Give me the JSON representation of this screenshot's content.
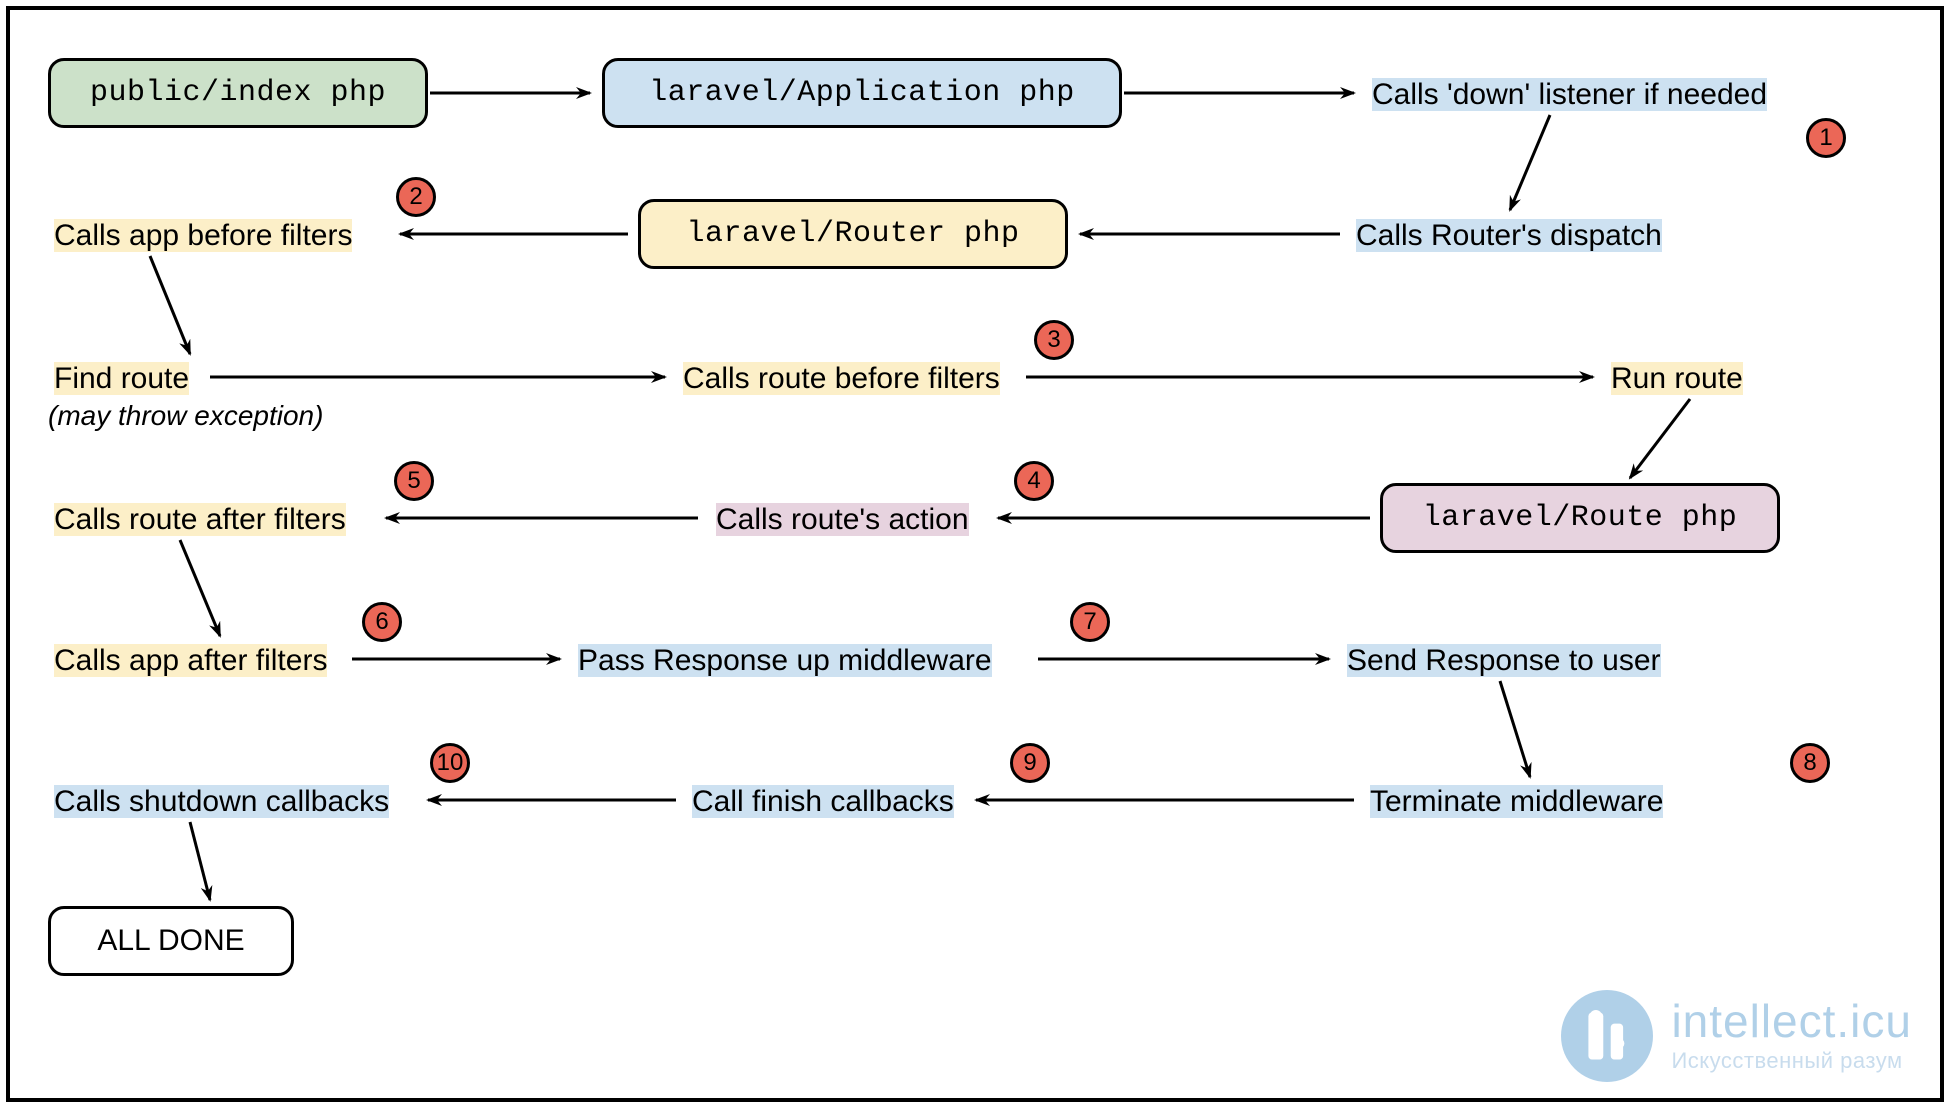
{
  "nodes": {
    "n1": {
      "label": "public/index php"
    },
    "n2": {
      "label": "laravel/Application php"
    },
    "n3": {
      "label": "Calls 'down' listener if needed"
    },
    "n4": {
      "label": "Calls Router's dispatch"
    },
    "n5": {
      "label": "laravel/Router php"
    },
    "n6": {
      "label": "Calls app before filters"
    },
    "n7": {
      "label": "Find route",
      "note": "(may throw exception)"
    },
    "n8": {
      "label": "Calls route before filters"
    },
    "n9": {
      "label": "Run route"
    },
    "n10": {
      "label": "laravel/Route php"
    },
    "n11": {
      "label": "Calls route's action"
    },
    "n12": {
      "label": "Calls route after filters"
    },
    "n13": {
      "label": "Calls app after filters"
    },
    "n14": {
      "label": "Pass Response up middleware"
    },
    "n15": {
      "label": "Send Response to user"
    },
    "n16": {
      "label": "Terminate middleware"
    },
    "n17": {
      "label": "Call finish callbacks"
    },
    "n18": {
      "label": "Calls shutdown callbacks"
    },
    "n19": {
      "label": "ALL DONE"
    }
  },
  "badges": {
    "b1": "1",
    "b2": "2",
    "b3": "3",
    "b4": "4",
    "b5": "5",
    "b6": "6",
    "b7": "7",
    "b8": "8",
    "b9": "9",
    "b10": "10"
  },
  "watermark": {
    "brand": "intellect.icu",
    "tagline": "Искусственный разум"
  }
}
